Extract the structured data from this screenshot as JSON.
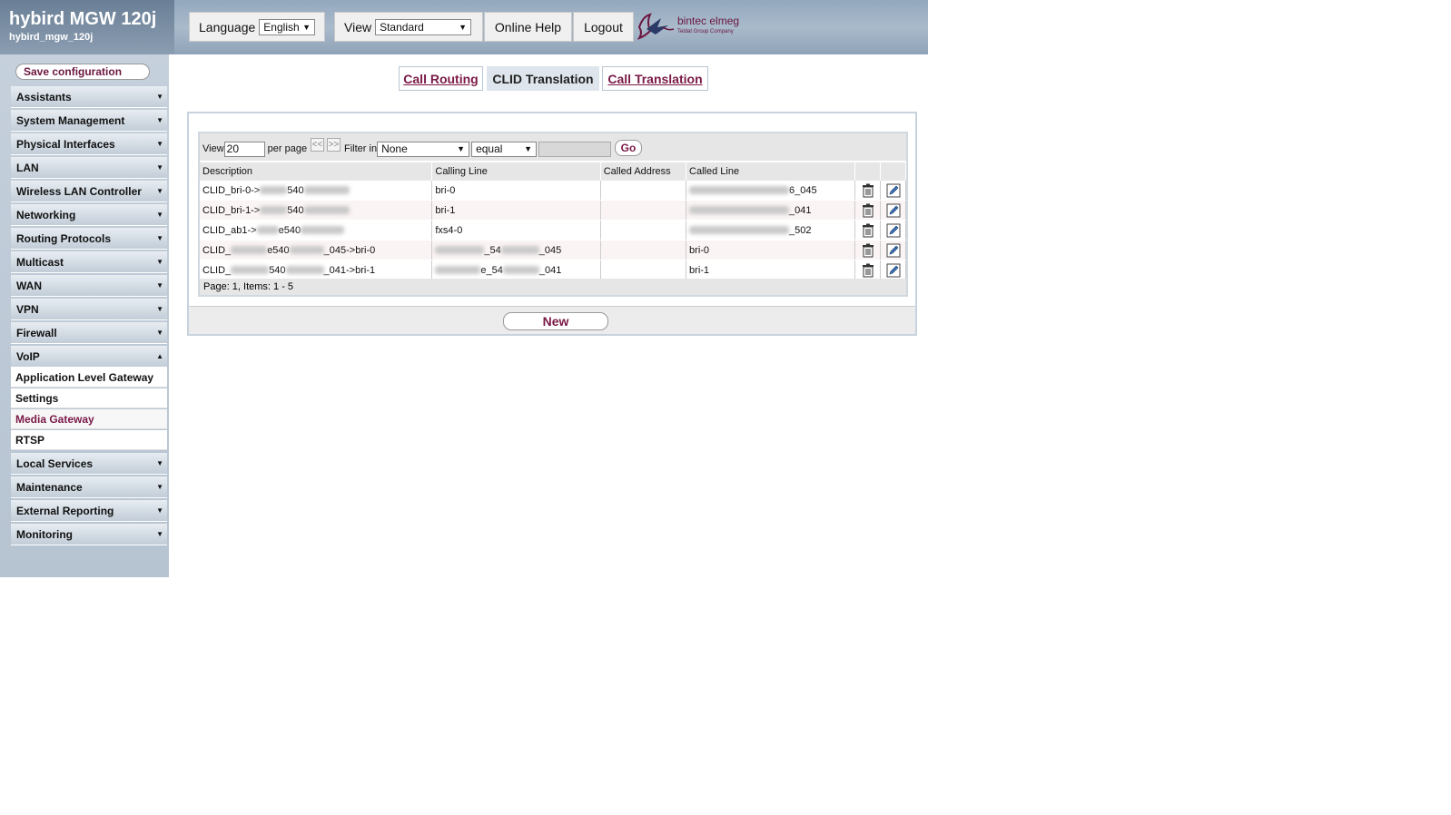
{
  "header": {
    "title": "hybird MGW 120j",
    "subtitle": "hybird_mgw_120j",
    "language_label": "Language",
    "language_value": "English",
    "view_label": "View",
    "view_value": "Standard",
    "online_help": "Online Help",
    "logout": "Logout",
    "logo_text": "bintec elmeg",
    "logo_sub": "Teldat Group Company"
  },
  "sidebar": {
    "save_label": "Save configuration",
    "items": [
      {
        "label": "Assistants"
      },
      {
        "label": "System Management"
      },
      {
        "label": "Physical Interfaces"
      },
      {
        "label": "LAN"
      },
      {
        "label": "Wireless LAN Controller"
      },
      {
        "label": "Networking"
      },
      {
        "label": "Routing Protocols"
      },
      {
        "label": "Multicast"
      },
      {
        "label": "WAN"
      },
      {
        "label": "VPN"
      },
      {
        "label": "Firewall"
      },
      {
        "label": "VoIP"
      }
    ],
    "voip_sub": [
      {
        "label": "Application Level Gateway"
      },
      {
        "label": "Settings"
      },
      {
        "label": "Media Gateway"
      },
      {
        "label": "RTSP"
      }
    ],
    "items_after": [
      {
        "label": "Local Services"
      },
      {
        "label": "Maintenance"
      },
      {
        "label": "External Reporting"
      },
      {
        "label": "Monitoring"
      }
    ]
  },
  "tabs": [
    {
      "label": "Call Routing"
    },
    {
      "label": "CLID Translation"
    },
    {
      "label": "Call Translation"
    }
  ],
  "filter": {
    "view_label": "View",
    "view_value": "20",
    "per_page_label": "per page",
    "prev_label": "<<",
    "next_label": ">>",
    "filter_in_label": "Filter in",
    "filter_field": "None",
    "filter_op": "equal",
    "filter_value": "",
    "go_label": "Go"
  },
  "table": {
    "columns": [
      "Description",
      "Calling Line",
      "Called Address",
      "Called Line"
    ],
    "rows": [
      {
        "desc_a": "CLID_bri-0->",
        "desc_b": "540",
        "desc_c": "",
        "calling": "bri-0",
        "called_address": "",
        "called_line_a": "",
        "called_line_b": "6_045"
      },
      {
        "desc_a": "CLID_bri-1->",
        "desc_b": "540",
        "desc_c": "",
        "calling": "bri-1",
        "called_address": "",
        "called_line_a": "",
        "called_line_b": "_041"
      },
      {
        "desc_a": "CLID_ab1->",
        "desc_b": "e540",
        "desc_c": "",
        "calling": "fxs4-0",
        "called_address": "",
        "called_line_a": "",
        "called_line_b": "_502"
      },
      {
        "desc_a": "CLID_",
        "desc_b": "e540",
        "desc_c": "_045->bri-0",
        "calling_a": "",
        "calling_b": "_54",
        "calling_c": "_045",
        "called_address": "",
        "called_line": "bri-0"
      },
      {
        "desc_a": "CLID_",
        "desc_b": "540",
        "desc_c": "_041->bri-1",
        "calling_a": "",
        "calling_b": "e_54",
        "calling_c": "_041",
        "called_address": "",
        "called_line": "bri-1"
      }
    ],
    "page_info": "Page:  1, Items:  1 - 5"
  },
  "new_label": "New",
  "icons": {
    "delete": "trash-icon",
    "edit": "edit-icon"
  }
}
